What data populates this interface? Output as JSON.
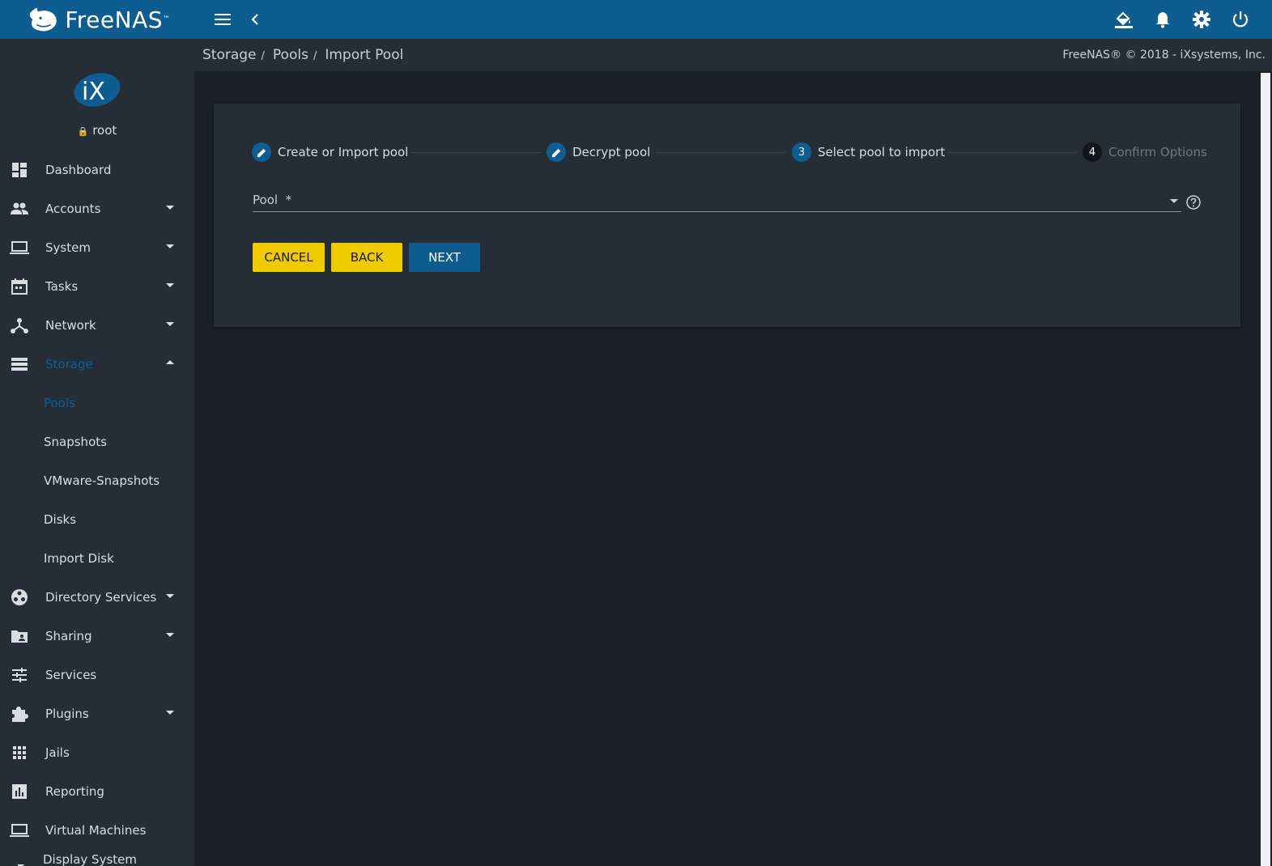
{
  "app": {
    "brand": "FreeNAS",
    "brand_tm": "™"
  },
  "topbar": {
    "icons": [
      "menu-icon",
      "chevron-left-icon",
      "paint-bucket-icon",
      "bell-icon",
      "gear-icon",
      "power-icon"
    ]
  },
  "user": {
    "name": "root"
  },
  "sidebar": {
    "items": [
      {
        "label": "Dashboard",
        "icon": "dashboard-icon"
      },
      {
        "label": "Accounts",
        "icon": "people-icon"
      },
      {
        "label": "System",
        "icon": "laptop-icon"
      },
      {
        "label": "Tasks",
        "icon": "calendar-icon"
      },
      {
        "label": "Network",
        "icon": "network-icon"
      },
      {
        "label": "Storage",
        "icon": "storage-icon"
      },
      {
        "label": "Directory Services",
        "icon": "directory-icon"
      },
      {
        "label": "Sharing",
        "icon": "folder-shared-icon"
      },
      {
        "label": "Services",
        "icon": "tune-icon"
      },
      {
        "label": "Plugins",
        "icon": "puzzle-icon"
      },
      {
        "label": "Jails",
        "icon": "grid-icon"
      },
      {
        "label": "Reporting",
        "icon": "chart-icon"
      },
      {
        "label": "Virtual Machines",
        "icon": "laptop-icon"
      },
      {
        "label": "Display System",
        "icon": "arrow-icon"
      }
    ],
    "storage_sub": [
      {
        "label": "Pools"
      },
      {
        "label": "Snapshots"
      },
      {
        "label": "VMware-Snapshots"
      },
      {
        "label": "Disks"
      },
      {
        "label": "Import Disk"
      }
    ]
  },
  "breadcrumb": {
    "items": [
      "Storage",
      "Pools",
      "Import Pool"
    ],
    "separator": "/"
  },
  "copyright": "FreeNAS® © 2018 - iXsystems, Inc.",
  "stepper": {
    "steps": [
      {
        "number": "",
        "label": "Create or Import pool"
      },
      {
        "number": "",
        "label": "Decrypt pool"
      },
      {
        "number": "3",
        "label": "Select pool to import"
      },
      {
        "number": "4",
        "label": "Confirm Options"
      }
    ]
  },
  "form": {
    "pool_label": "Pool",
    "required_mark": "*"
  },
  "buttons": {
    "cancel": "CANCEL",
    "back": "BACK",
    "next": "NEXT"
  },
  "colors": {
    "accent": "#0f5c91",
    "warning": "#f0cb00",
    "background": "#1a2028",
    "panel": "#252d36"
  }
}
